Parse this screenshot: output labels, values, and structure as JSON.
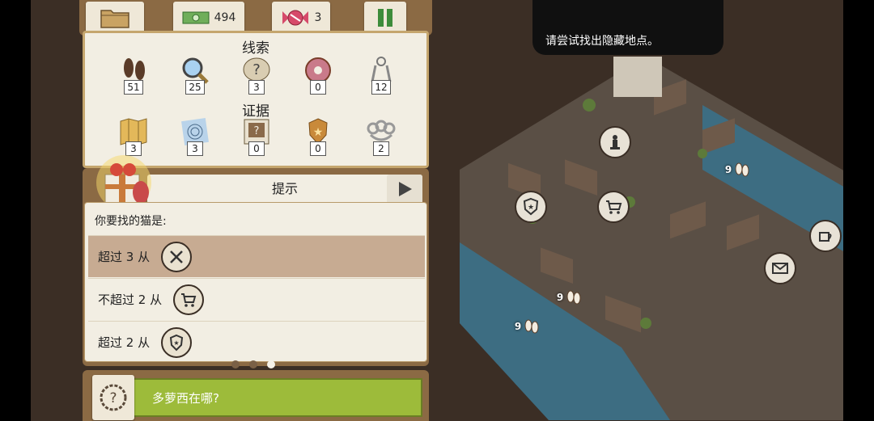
{
  "topbar": {
    "money": "494",
    "candy": "3"
  },
  "clues": {
    "title": "线索",
    "items": [
      {
        "icon": "footprints-icon",
        "count": "51"
      },
      {
        "icon": "magnifier-icon",
        "count": "25"
      },
      {
        "icon": "question-bubble-icon",
        "count": "3"
      },
      {
        "icon": "donut-icon",
        "count": "0"
      },
      {
        "icon": "keys-icon",
        "count": "12"
      }
    ]
  },
  "evidence": {
    "title": "证据",
    "items": [
      {
        "icon": "map-icon",
        "count": "3"
      },
      {
        "icon": "fingerprint-icon",
        "count": "3"
      },
      {
        "icon": "mystery-photo-icon",
        "count": "0"
      },
      {
        "icon": "police-badge-icon",
        "count": "0"
      },
      {
        "icon": "brass-knuckles-icon",
        "count": "2"
      }
    ]
  },
  "hint": {
    "title": "提示",
    "question": "你要找的猫是:",
    "rows": [
      {
        "text": "超过 3 从",
        "icon": "restaurant-icon",
        "selected": true
      },
      {
        "text": "不超过 2 从",
        "icon": "shopping-cart-icon",
        "selected": false
      },
      {
        "text": "超过 2 从",
        "icon": "police-icon",
        "selected": false
      }
    ]
  },
  "bottom": {
    "text": "多萝西在哪?"
  },
  "map": {
    "tooltip": "请尝试找出隐藏地点。",
    "footprint_counts": [
      "9",
      "9",
      "9"
    ]
  },
  "colors": {
    "panel_brown": "#8b6a44",
    "card": "#f2eee3",
    "selected_row": "#c7ab92",
    "bottom_bar": "#9dbb3a"
  }
}
